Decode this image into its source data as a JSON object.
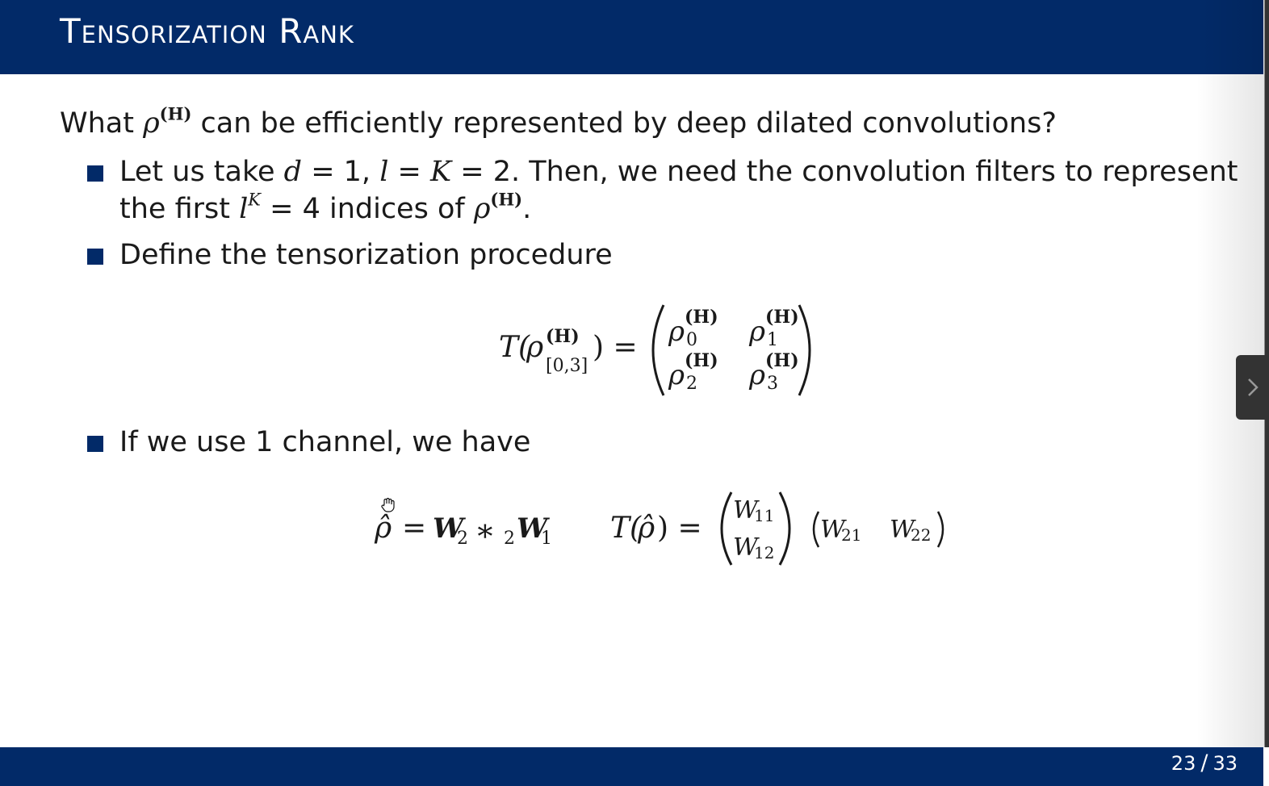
{
  "slide": {
    "title": "Tensorization Rank",
    "intro": {
      "before": "What ",
      "rho": "ρ",
      "sup": "(H)",
      "after": " can be efficiently represented by deep dilated convolutions?"
    },
    "bullet1": {
      "t1": "Let us take ",
      "d": "d",
      "t2": " = 1, ",
      "l": "l",
      "t3": " = ",
      "K": "K",
      "t4": " = 2. Then, we need the convolution filters to represent",
      "t5": "the first ",
      "l2": "l",
      "supK": "K",
      "t6": " = 4 indices of ",
      "rho": "ρ",
      "sup": "(H)",
      "t7": "."
    },
    "bullet2": {
      "text": "Define the tensorization procedure"
    },
    "bullet3": {
      "text": "If we use 1 channel, we have"
    },
    "equation1": {
      "lhs_T": "T(",
      "lhs_rho": "ρ",
      "lhs_sup": "(H)",
      "lhs_sub": "[0,3]",
      "lhs_close": ") =",
      "cells": [
        {
          "base": "ρ",
          "sup": "(H)",
          "sub": "0"
        },
        {
          "base": "ρ",
          "sup": "(H)",
          "sub": "1"
        },
        {
          "base": "ρ",
          "sup": "(H)",
          "sub": "2"
        },
        {
          "base": "ρ",
          "sup": "(H)",
          "sub": "3"
        }
      ]
    },
    "equation2": {
      "rho_hat": "ρ̂",
      "eq": "=",
      "w2": "W",
      "w2_sub": "2",
      "conv": "∗",
      "conv_sub": "2",
      "w1": "W",
      "w1_sub": "1",
      "T": "T(",
      "T_rho_hat": "ρ̂",
      "T_close": ") =",
      "col": [
        {
          "base": "W",
          "sub": "11"
        },
        {
          "base": "W",
          "sub": "12"
        }
      ],
      "row": [
        {
          "base": "W",
          "sub": "21"
        },
        {
          "base": "W",
          "sub": "22"
        }
      ]
    },
    "footer": {
      "page": "23",
      "total": "33"
    }
  }
}
